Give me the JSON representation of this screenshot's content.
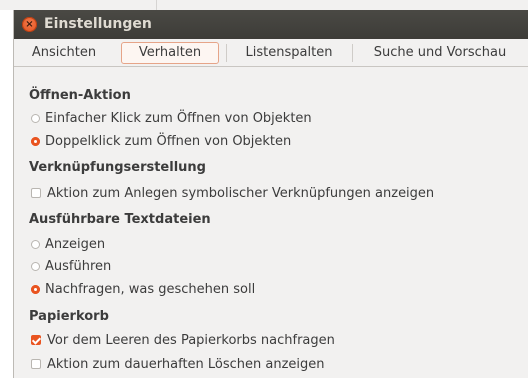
{
  "window": {
    "title": "Einstellungen"
  },
  "tabs": [
    {
      "label": "Ansichten",
      "active": false
    },
    {
      "label": "Verhalten",
      "active": true
    },
    {
      "label": "Listenspalten",
      "active": false
    },
    {
      "label": "Suche und Vorschau",
      "active": false
    }
  ],
  "sections": {
    "open_action": {
      "heading": "Öffnen-Aktion",
      "options": [
        {
          "label": "Einfacher Klick zum Öffnen von Objekten",
          "selected": false
        },
        {
          "label": "Doppelklick zum Öffnen von Objekten",
          "selected": true
        }
      ]
    },
    "link_creation": {
      "heading": "Verknüpfungserstellung",
      "options": [
        {
          "label": "Aktion zum Anlegen symbolischer Verknüpfungen anzeigen",
          "checked": false
        }
      ]
    },
    "executable_text": {
      "heading": "Ausführbare Textdateien",
      "options": [
        {
          "label": "Anzeigen",
          "selected": false
        },
        {
          "label": "Ausführen",
          "selected": false
        },
        {
          "label": "Nachfragen, was geschehen soll",
          "selected": true
        }
      ]
    },
    "trash": {
      "heading": "Papierkorb",
      "options": [
        {
          "label": "Vor dem Leeren des Papierkorbs nachfragen",
          "checked": true
        },
        {
          "label": "Aktion zum dauerhaften Löschen anzeigen",
          "checked": false
        }
      ]
    }
  },
  "colors": {
    "accent": "#e95420",
    "titlebar": "#3d3c38",
    "background": "#f2f1f0"
  }
}
